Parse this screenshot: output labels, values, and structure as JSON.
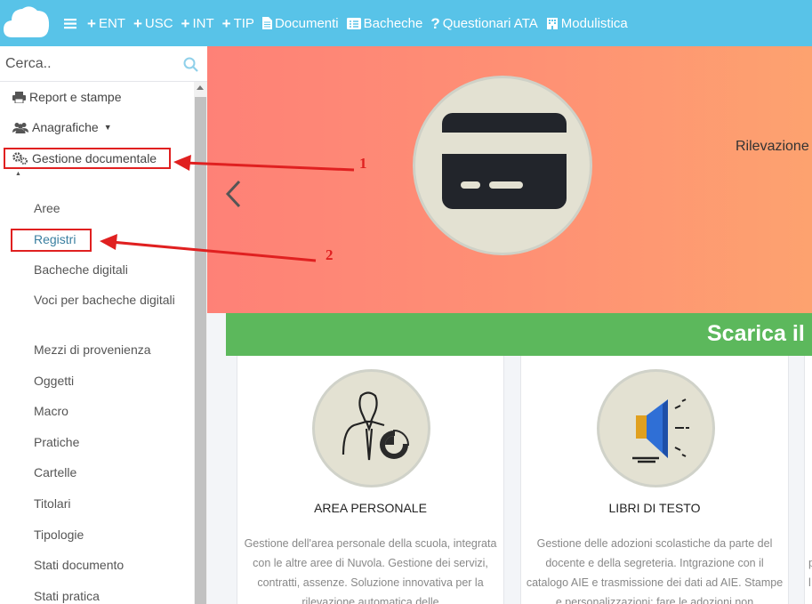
{
  "topbar": {
    "items": [
      {
        "icon": "hamburger-icon",
        "label": ""
      },
      {
        "icon": "plus-icon",
        "label": "ENT"
      },
      {
        "icon": "plus-icon",
        "label": "USC"
      },
      {
        "icon": "plus-icon",
        "label": "INT"
      },
      {
        "icon": "plus-icon",
        "label": "TIP"
      },
      {
        "icon": "document-icon",
        "label": "Documenti"
      },
      {
        "icon": "board-icon",
        "label": "Bacheche"
      },
      {
        "icon": "question-icon",
        "label": "Questionari ATA"
      },
      {
        "icon": "building-icon",
        "label": "Modulistica"
      }
    ],
    "color": "#58c3e8"
  },
  "search": {
    "placeholder": "Cerca.."
  },
  "sidebar": {
    "report": "Report e stampe",
    "anagrafiche": "Anagrafiche",
    "gestione": "Gestione documentale",
    "sub": [
      "Aree",
      "Registri",
      "Bacheche digitali",
      "Voci per bacheche digitali",
      "Mezzi di provenienza",
      "Oggetti",
      "Macro",
      "Pratiche",
      "Cartelle",
      "Titolari",
      "Tipologie",
      "Stati documento",
      "Stati pratica"
    ]
  },
  "annotations": {
    "one": "1",
    "two": "2",
    "color": "#e02020"
  },
  "hero": {
    "text": "Rilevazione"
  },
  "banner": {
    "title": "Scarica il m",
    "color": "#5cb85c"
  },
  "cards": [
    {
      "title": "AREA PERSONALE",
      "desc": "Gestione dell'area personale della scuola, integrata con le altre aree di Nuvola. Gestione dei servizi, contratti, assenze. Soluzione innovativa per la rilevazione automatica delle"
    },
    {
      "title": "LIBRI DI TESTO",
      "desc": "Gestione delle adozioni scolastiche da parte del docente e della segreteria. Intgrazione con il catalogo AIE e trasmissione dei dati ad AIE. Stampe e personalizzazioni: fare le adozioni non"
    },
    {
      "title": "",
      "desc": "p\nl"
    }
  ]
}
